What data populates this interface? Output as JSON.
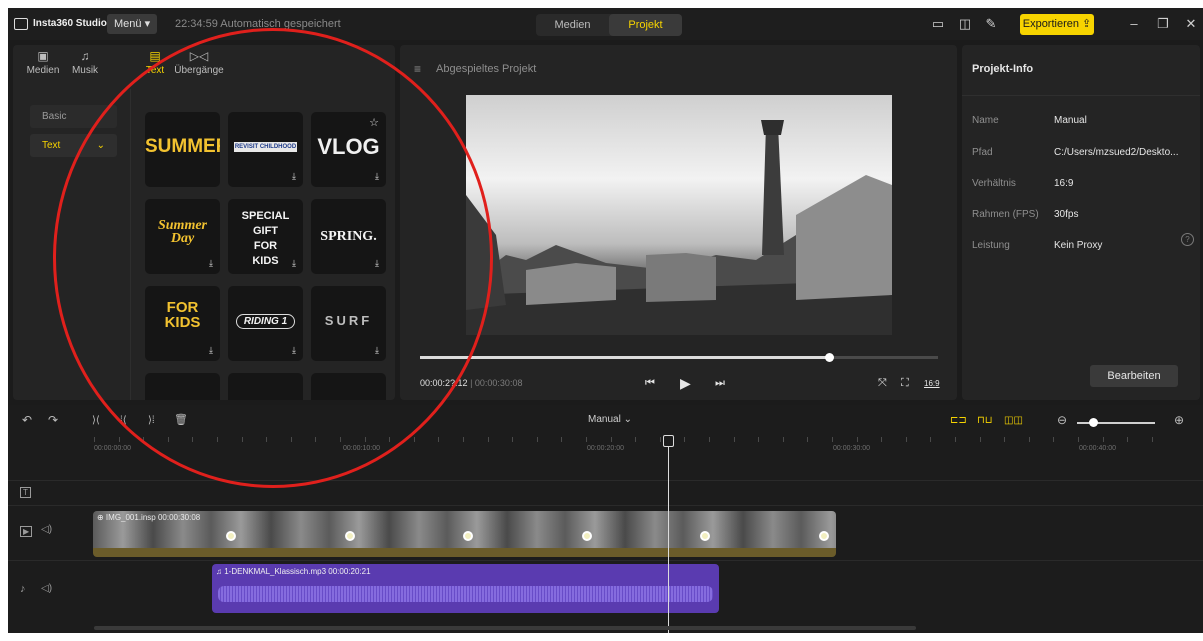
{
  "app": {
    "name": "Insta360 Studio",
    "menu_label": "Menü ▾",
    "autosave": "22:34:59 Automatisch gespeichert"
  },
  "top_tabs": [
    {
      "label": "Medien"
    },
    {
      "label": "Projekt"
    }
  ],
  "export_label": "Exportieren ⇪",
  "media_tabs": [
    {
      "label": "Medien"
    },
    {
      "label": "Musik"
    },
    {
      "label": "Text"
    },
    {
      "label": "Übergänge"
    }
  ],
  "text_categories": [
    {
      "label": "Basic"
    },
    {
      "label": "Text"
    }
  ],
  "templates": [
    {
      "text": "SUMMER"
    },
    {
      "text": "REVISIT CHILDHOOD"
    },
    {
      "text": "VLOG"
    },
    {
      "text": "Summer Day"
    },
    {
      "text": "SPECIAL GIFT FOR KIDS"
    },
    {
      "text": "SPRING."
    },
    {
      "text": "FOR KIDS"
    },
    {
      "text": "RIDING 1"
    },
    {
      "text": "SURF"
    }
  ],
  "preview": {
    "title": "Abgespieltes Projekt",
    "current_time": "00:00:2?:12",
    "total_time": "00:00:30:08",
    "progress": 0.79,
    "aspect_label": "16:9"
  },
  "info": {
    "title": "Projekt-Info",
    "rows": [
      {
        "key": "Name",
        "value": "Manual"
      },
      {
        "key": "Pfad",
        "value": "C:/Users/mzsued2/Deskto..."
      },
      {
        "key": "Verhältnis",
        "value": "16:9"
      },
      {
        "key": "Rahmen (FPS)",
        "value": "30fps"
      },
      {
        "key": "Leistung",
        "value": "Kein Proxy"
      }
    ],
    "help": "?",
    "edit_label": "Bearbeiten"
  },
  "timeline": {
    "project_label": "Manual ⌄",
    "ticks": [
      "00:00:00:00",
      "00:00:10:00",
      "00:00:20:00",
      "00:00:30:00",
      "00:00:40:00"
    ],
    "video_clip_label": "⊕ IMG_001.insp  00:00:30:08",
    "audio_clip_label": "♫ 1-DENKMAL_Klassisch.mp3  00:00:20:21",
    "zoom_level": 0.2
  },
  "icons": {
    "undo": "↶",
    "redo": "↷",
    "split": "⟩⟨",
    "delete": "🗑",
    "text_track": "T",
    "video_track": "▶",
    "audio_track": "♪",
    "volume": "🔊"
  }
}
